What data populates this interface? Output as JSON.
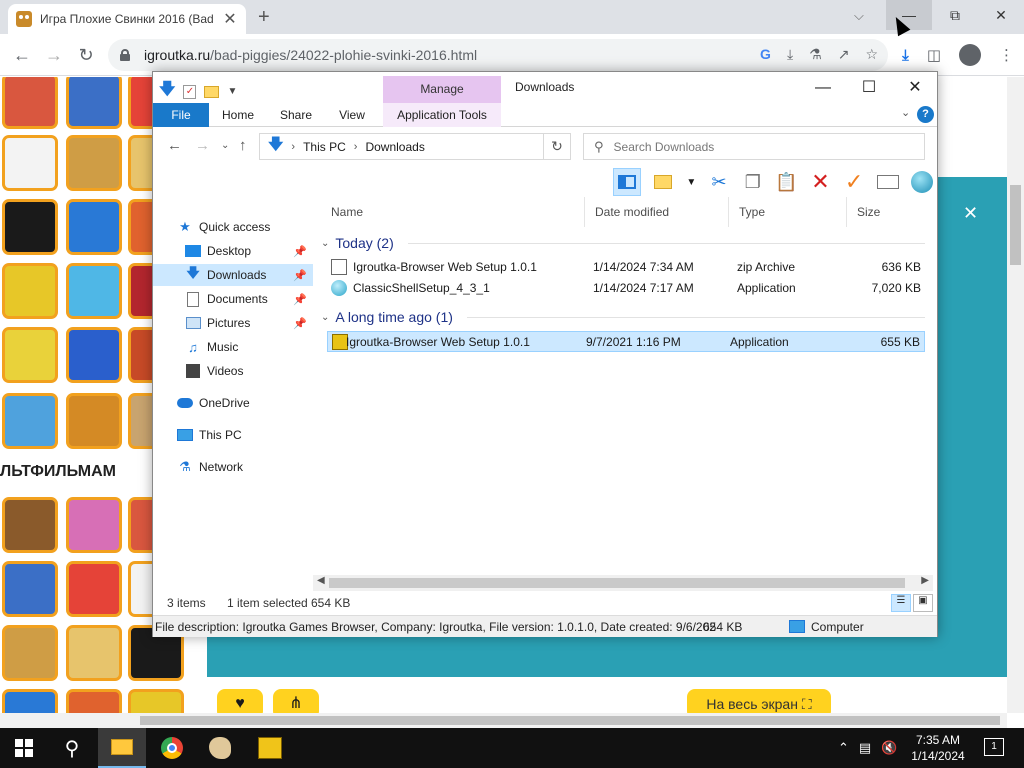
{
  "browser": {
    "tab_title": "Игра Плохие Свинки 2016 (Bad",
    "url_host": "igroutka.ru",
    "url_path": "/bad-piggies/24022-plohie-svinki-2016.html",
    "tab_close": "✕",
    "new_tab": "+",
    "tab_search": "⌵"
  },
  "webpage": {
    "heading": "ЛЬТФИЛЬМАМ",
    "fullscreen_button": "На весь экран ⛶",
    "game_close": "✕",
    "like_icon": "♥",
    "share_icon": "⋔",
    "thumb_colors": [
      "#d9573f",
      "#3b6fc6",
      "#e54338",
      "#f3f3f3",
      "#cf9d45",
      "#e7c46c",
      "#1a1a1a",
      "#2979d6",
      "#e0622e",
      "#e7c728",
      "#4fb7e6",
      "#b3262e",
      "#e9d23a",
      "#2a5fcc",
      "#c74a27",
      "#4fa2dd",
      "#d48a25",
      "#c8a46f",
      "#8a5a2b",
      "#d76fb6"
    ]
  },
  "explorer": {
    "title": "Downloads",
    "manage_tab": "Manage",
    "ribbon_tabs": [
      "File",
      "Home",
      "Share",
      "View",
      "Application Tools"
    ],
    "breadcrumb": [
      "This PC",
      "Downloads"
    ],
    "search_placeholder": "Search Downloads",
    "nav": {
      "quick_access": "Quick access",
      "desktop": "Desktop",
      "downloads": "Downloads",
      "documents": "Documents",
      "pictures": "Pictures",
      "music": "Music",
      "videos": "Videos",
      "onedrive": "OneDrive",
      "this_pc": "This PC",
      "network": "Network"
    },
    "columns": [
      "Name",
      "Date modified",
      "Type",
      "Size"
    ],
    "groups": [
      {
        "label": "Today (2)",
        "files": [
          {
            "name": "Igroutka-Browser Web Setup 1.0.1",
            "date": "1/14/2024 7:34 AM",
            "type": "zip Archive",
            "size": "636 KB"
          },
          {
            "name": "ClassicShellSetup_4_3_1",
            "date": "1/14/2024 7:17 AM",
            "type": "Application",
            "size": "7,020 KB"
          }
        ]
      },
      {
        "label": "A long time ago (1)",
        "files": [
          {
            "name": "Igroutka-Browser Web Setup 1.0.1",
            "date": "9/7/2021 1:16 PM",
            "type": "Application",
            "size": "655 KB"
          }
        ]
      }
    ],
    "status": {
      "items": "3 items",
      "selected": "1 item selected",
      "size": "654 KB"
    },
    "info_bar": {
      "description": "File description: Igroutka Games Browser, Company: Igroutka, File version: 1.0.1.0, Date created: 9/6/202",
      "size": "654 KB",
      "location": "Computer"
    }
  },
  "taskbar": {
    "time": "7:35 AM",
    "date": "1/14/2024",
    "notifications": "1"
  }
}
